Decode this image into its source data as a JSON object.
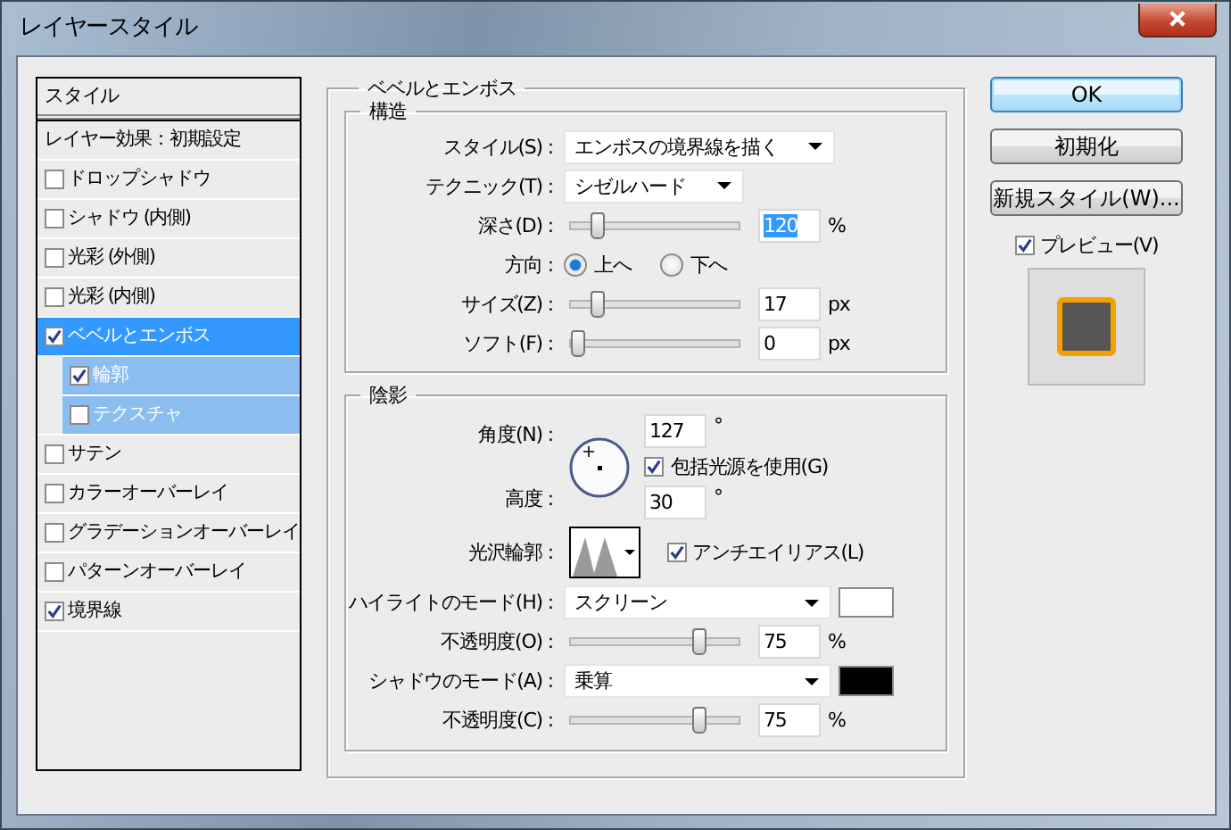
{
  "window": {
    "title": "レイヤースタイル"
  },
  "styles_list": {
    "header": "スタイル",
    "default_item": "レイヤー効果：初期設定",
    "items": [
      {
        "label": "ドロップシャドウ",
        "checked": false,
        "selected": false
      },
      {
        "label": "シャドウ (内側)",
        "checked": false,
        "selected": false
      },
      {
        "label": "光彩 (外側)",
        "checked": false,
        "selected": false
      },
      {
        "label": "光彩 (内側)",
        "checked": false,
        "selected": false
      },
      {
        "label": "ベベルとエンボス",
        "checked": true,
        "selected": true,
        "children": [
          {
            "label": "輪郭",
            "checked": true,
            "selected": false
          },
          {
            "label": "テクスチャ",
            "checked": false,
            "selected": false
          }
        ]
      },
      {
        "label": "サテン",
        "checked": false,
        "selected": false
      },
      {
        "label": "カラーオーバーレイ",
        "checked": false,
        "selected": false
      },
      {
        "label": "グラデーションオーバーレイ",
        "checked": false,
        "selected": false
      },
      {
        "label": "パターンオーバーレイ",
        "checked": false,
        "selected": false
      },
      {
        "label": "境界線",
        "checked": true,
        "selected": false
      }
    ]
  },
  "bevel": {
    "title": "ベベルとエンボス",
    "structure": {
      "title": "構造",
      "rows": [
        {
          "kind": "select",
          "label": "スタイル(S) :",
          "value": "エンボスの境界線を描く",
          "wide": true
        },
        {
          "kind": "select",
          "label": "テクニック(T) :",
          "value": "シゼルハード",
          "wide": false
        },
        {
          "kind": "slider",
          "label": "深さ(D) :",
          "level": 0.12,
          "value": "120",
          "unit": "%",
          "text_selected": true
        },
        {
          "kind": "radio",
          "label": "方向 :",
          "options": [
            {
              "label": "上へ",
              "selected": true
            },
            {
              "label": "下へ",
              "selected": false
            }
          ]
        },
        {
          "kind": "slider",
          "label": "サイズ(Z) :",
          "level": 0.12,
          "value": "17",
          "unit": "px",
          "text_selected": false
        },
        {
          "kind": "slider",
          "label": "ソフト(F) :",
          "level": 0,
          "value": "0",
          "unit": "px",
          "text_selected": false
        }
      ]
    },
    "shading": {
      "title": "陰影",
      "angle_label": "角度(N) :",
      "angle": "127",
      "angle_unit": "°",
      "global_light": {
        "label": "包括光源を使用(G)",
        "checked": true
      },
      "altitude_label": "高度 :",
      "altitude": "30",
      "altitude_unit": "°",
      "gloss_label": "光沢輪郭 :",
      "anti_alias": {
        "label": "アンチエイリアス(L)",
        "checked": true
      },
      "modes": [
        {
          "label": "ハイライトのモード(H) :",
          "value": "スクリーン",
          "color": "#ffffff",
          "opacity_label": "不透明度(O) :",
          "level": 0.75,
          "opacity": "75",
          "unit": "%"
        },
        {
          "label": "シャドウのモード(A) :",
          "value": "乗算",
          "color": "#000000",
          "opacity_label": "不透明度(C) :",
          "level": 0.75,
          "opacity": "75",
          "unit": "%"
        }
      ]
    }
  },
  "buttons": [
    {
      "label": "OK",
      "default": true
    },
    {
      "label": "初期化",
      "default": false
    },
    {
      "label": "新規スタイル(W)...",
      "default": false
    }
  ],
  "preview": {
    "label": "プレビュー(V)",
    "checked": true
  }
}
